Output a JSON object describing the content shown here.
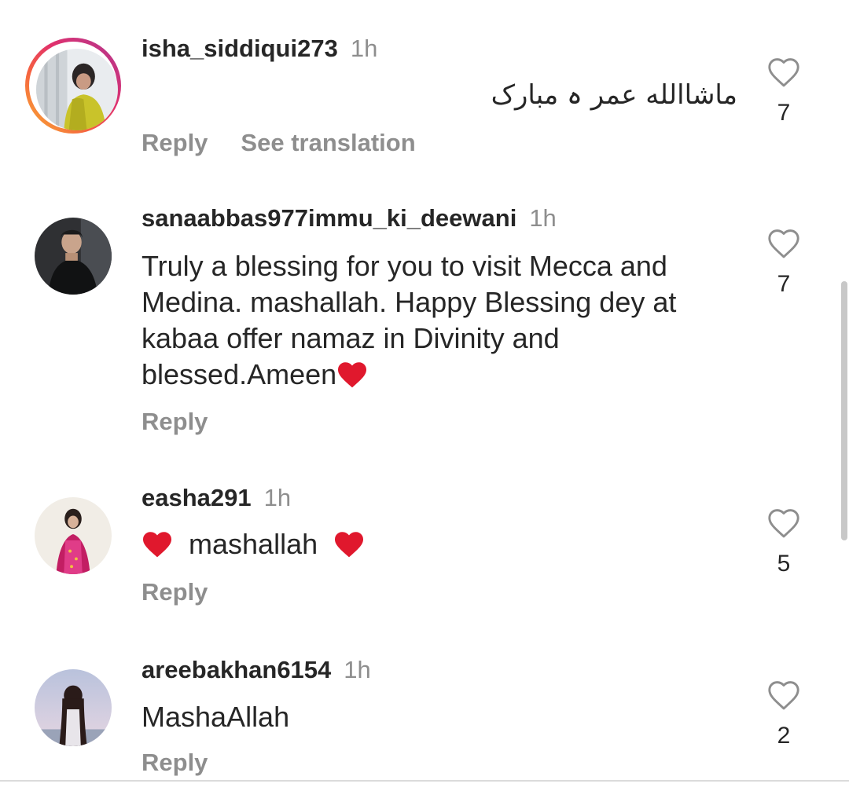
{
  "comments": [
    {
      "username": "isha_siddiqui273",
      "time": "1h",
      "text": "ماشاالله عمر ہ مبارک",
      "reply_label": "Reply",
      "translation_label": "See translation",
      "likes": "7"
    },
    {
      "username": "sanaabbas977immu_ki_deewani",
      "time": "1h",
      "text": "Truly a blessing for you to visit Mecca and Medina. mashallah. Happy Blessing dey at kabaa offer namaz in Divinity and blessed.Ameen",
      "reply_label": "Reply",
      "likes": "7"
    },
    {
      "username": "easha291",
      "time": "1h",
      "text": "mashallah",
      "reply_label": "Reply",
      "likes": "5"
    },
    {
      "username": "areebakhan6154",
      "time": "1h",
      "text": "MashaAllah",
      "reply_label": "Reply",
      "likes": "2"
    }
  ],
  "icons": {
    "like": "heart-outline-icon",
    "emoji": "red-heart-emoji"
  },
  "colors": {
    "username": "#262626",
    "muted": "#8e8e8e",
    "emoji_heart": "#e0182d"
  }
}
